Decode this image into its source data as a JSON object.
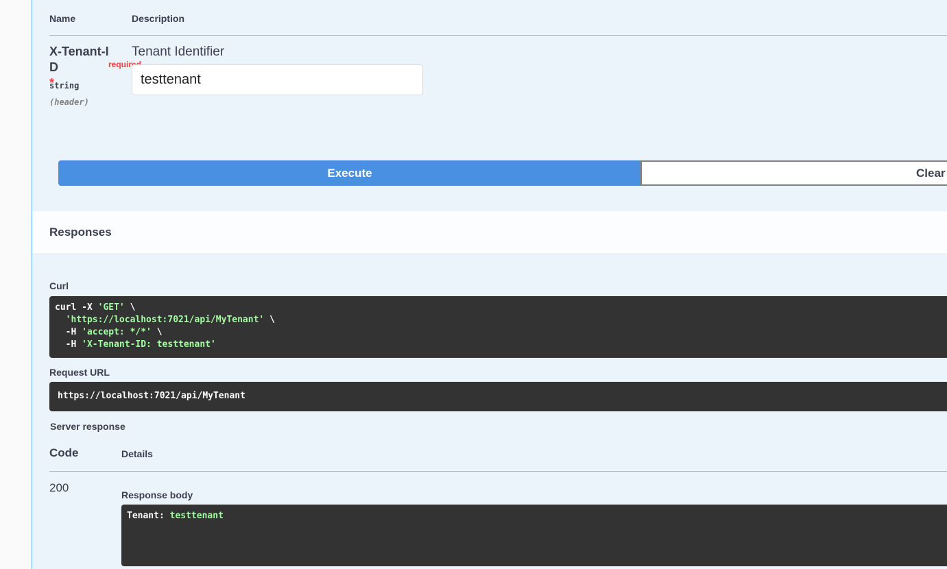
{
  "parameters": {
    "header_name": "Name",
    "header_description": "Description",
    "items": [
      {
        "name": "X-Tenant-ID",
        "required_star": "*",
        "required_label": "required",
        "type": "string",
        "in": "(header)",
        "description": "Tenant Identifier",
        "value": "testtenant"
      }
    ]
  },
  "actions": {
    "execute_label": "Execute",
    "clear_label": "Clear"
  },
  "responses": {
    "title": "Responses",
    "curl_label": "Curl",
    "curl": {
      "line1_cmd": "curl -X ",
      "line1_str": "'GET'",
      "line1_end": " \\",
      "line2_indent": "  ",
      "line2_str": "'https://localhost:7021/api/MyTenant'",
      "line2_end": " \\",
      "line3_cmd": "  -H ",
      "line3_str": "'accept: */*'",
      "line3_end": " \\",
      "line4_cmd": "  -H ",
      "line4_str": "'X-Tenant-ID: testtenant'"
    },
    "request_url_label": "Request URL",
    "request_url": "https://localhost:7021/api/MyTenant",
    "server_response_label": "Server response",
    "code_header": "Code",
    "details_header": "Details",
    "rows": [
      {
        "code": "200",
        "body_label": "Response body",
        "body_key": "Tenant: ",
        "body_value": "testtenant"
      }
    ]
  },
  "colors": {
    "execute": "#4990e2",
    "panel": "#ebf3fb",
    "code_bg": "#333333",
    "string": "#a2fca2",
    "required": "#f93e3e"
  }
}
